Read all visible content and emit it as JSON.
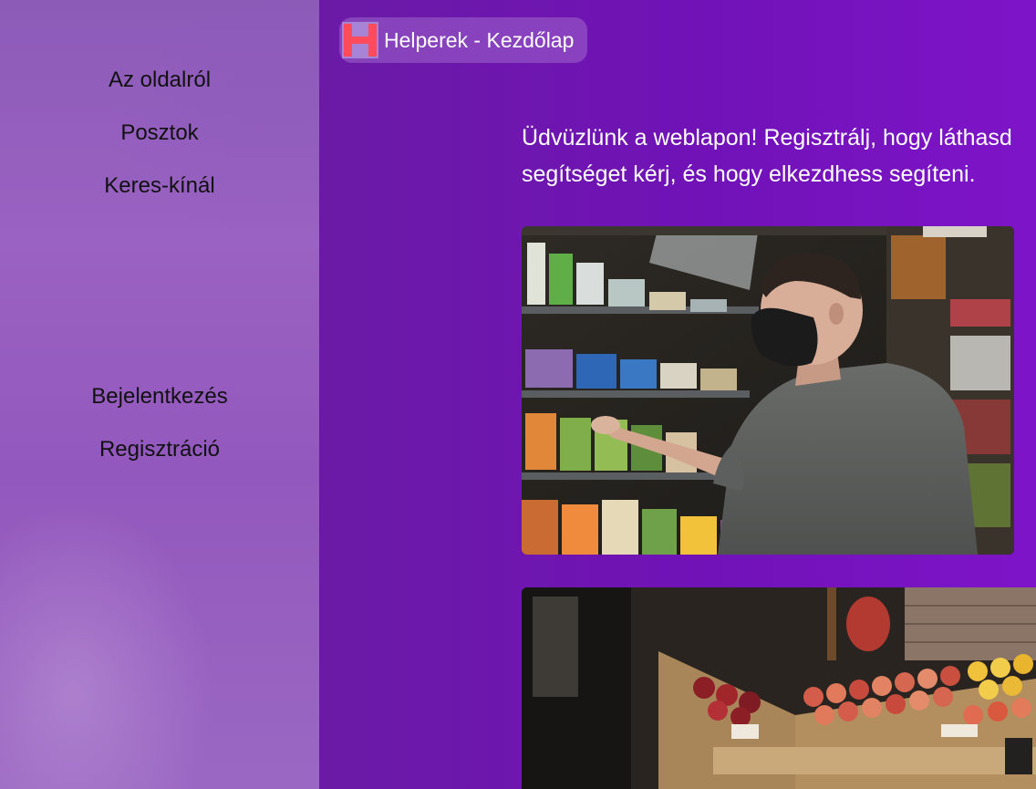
{
  "sidebar": {
    "top_links": [
      {
        "label": "Az oldalról"
      },
      {
        "label": "Posztok"
      },
      {
        "label": "Keres-kínál"
      }
    ],
    "bottom_links": [
      {
        "label": "Bejelentkezés"
      },
      {
        "label": "Regisztráció"
      }
    ]
  },
  "header": {
    "title": "Helperek - Kezdőlap",
    "logo_icon": "letter-h-logo-icon"
  },
  "main": {
    "welcome_line_1": "Üdvüzlünk a weblapon! Regisztrálj, hogy láthasd",
    "welcome_line_2": "segítséget kérj, és hogy elkezdhess segíteni."
  },
  "colors": {
    "sidebar": "#9358bd",
    "main_bg": "#7112b8",
    "logo_red": "#ff4b5c",
    "logo_lilac": "#a884d6"
  }
}
